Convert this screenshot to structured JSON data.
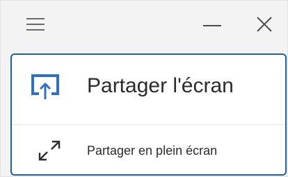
{
  "titlebar": {
    "menu_icon": "hamburger-menu-icon",
    "minimize_icon": "minimize-icon",
    "close_icon": "close-icon"
  },
  "options": {
    "share_screen": {
      "label": "Partager l'écran",
      "icon": "cast-screen-icon"
    },
    "share_fullscreen": {
      "label": "Partager en plein écran",
      "icon": "expand-arrows-icon"
    }
  },
  "colors": {
    "accent": "#1f5fa3",
    "icon_blue": "#2f6fc4",
    "text": "#2b2b2b",
    "background": "#f3f3f3"
  }
}
